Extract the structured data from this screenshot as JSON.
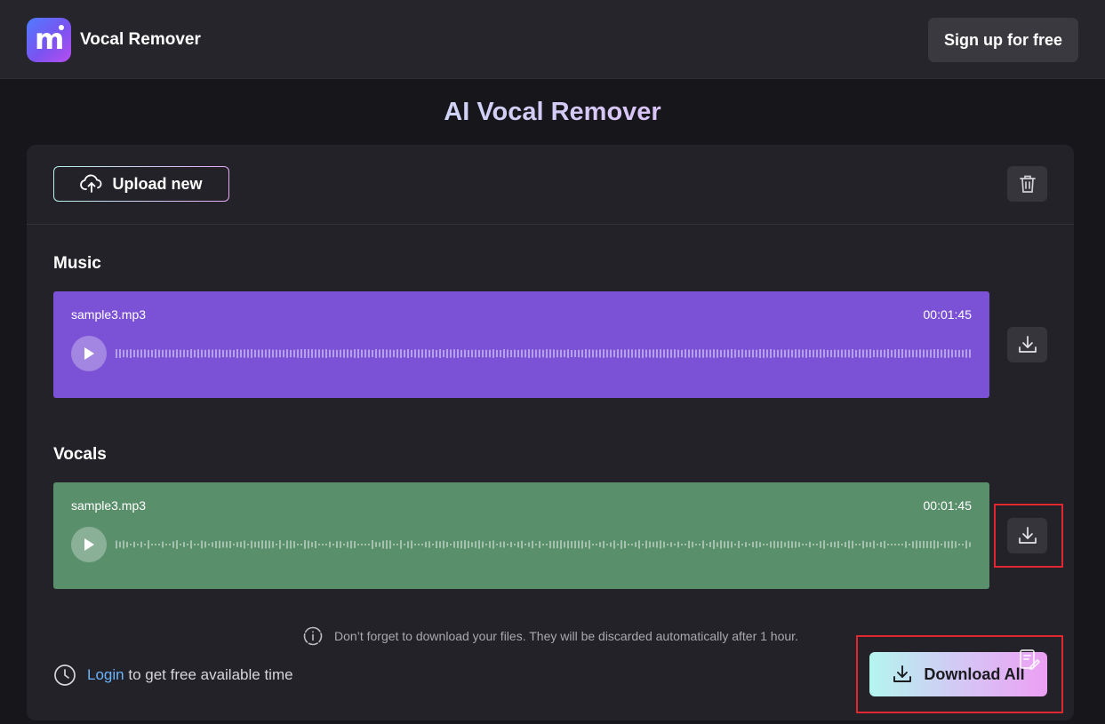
{
  "header": {
    "app_name": "Vocal Remover",
    "logo_letter": "m",
    "signup_label": "Sign up for free"
  },
  "page_title": "AI Vocal Remover",
  "toolbar": {
    "upload_label": "Upload new",
    "upload_icon": "cloud-upload-icon",
    "delete_icon": "trash-icon"
  },
  "tracks": [
    {
      "section": "Music",
      "file_name": "sample3.mp3",
      "duration": "00:01:45",
      "color": "#7b52d6"
    },
    {
      "section": "Vocals",
      "file_name": "sample3.mp3",
      "duration": "00:01:45",
      "color": "#5a8f6c"
    }
  ],
  "notice": {
    "icon": "info-icon",
    "text": "Don’t forget to download your files. They will be discarded automatically after 1 hour."
  },
  "login": {
    "icon": "clock-icon",
    "link": "Login",
    "text": "to get free available time"
  },
  "download_all_label": "Download All",
  "colors": {
    "background": "#17161b",
    "card": "#232228",
    "music_track": "#7b52d6",
    "vocals_track": "#5a8f6c",
    "link": "#6ab4ff",
    "highlight_box": "#e0262e"
  }
}
